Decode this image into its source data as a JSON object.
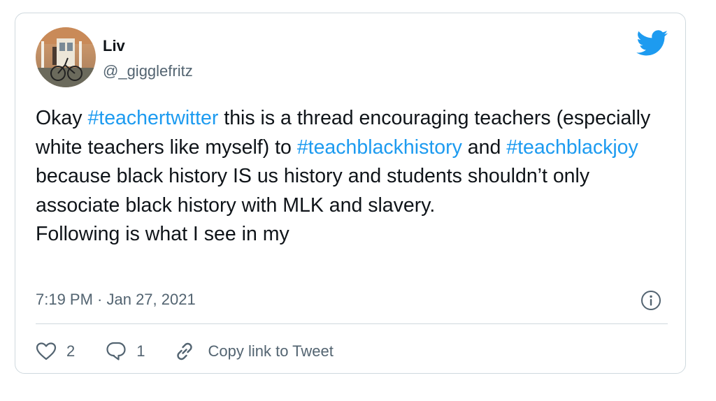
{
  "tweet": {
    "author_name": "Liv",
    "author_handle": "@_gigglefritz",
    "text_segments": [
      {
        "text": "Okay ",
        "type": "text"
      },
      {
        "text": "#teachertwitter",
        "type": "hashtag"
      },
      {
        "text": " this is a thread encouraging teachers (especially white teachers like myself) to ",
        "type": "text"
      },
      {
        "text": "#teachblackhistory",
        "type": "hashtag"
      },
      {
        "text": " and ",
        "type": "text"
      },
      {
        "text": "#teachblackjoy",
        "type": "hashtag"
      },
      {
        "text": " because black history IS us history and students shouldn’t only associate black history with MLK and slavery.",
        "type": "text"
      },
      {
        "text": "\n",
        "type": "break"
      },
      {
        "text": "Following is what I see in my",
        "type": "text"
      }
    ],
    "timestamp": "7:19 PM · Jan 27, 2021",
    "likes": "2",
    "replies": "1",
    "copy_link_label": "Copy link to Tweet"
  },
  "icons": {
    "logo": "twitter-bird-icon",
    "info": "info-icon",
    "like": "heart-icon",
    "reply": "reply-icon",
    "link": "link-icon"
  },
  "colors": {
    "brand": "#1d9bf0",
    "text": "#0f1419",
    "secondary": "#536471",
    "border": "#cfd9de"
  }
}
